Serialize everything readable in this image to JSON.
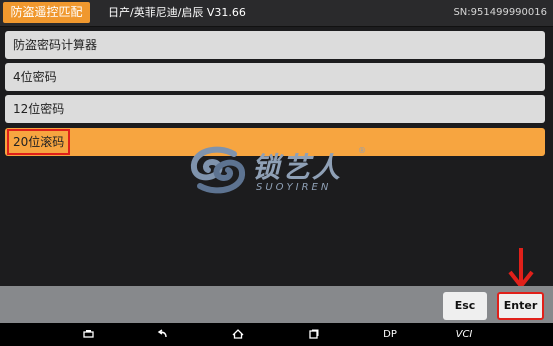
{
  "header": {
    "title": "防盗遥控匹配",
    "path": "日产/英菲尼迪/启辰  V31.66",
    "serial": "SN:951499990016"
  },
  "menu": {
    "items": [
      {
        "label": "防盗密码计算器"
      },
      {
        "label": "4位密码"
      },
      {
        "label": "12位密码"
      },
      {
        "label": "20位滚码",
        "selected": true
      }
    ]
  },
  "watermark": {
    "brand": "锁艺人",
    "sub": "SUOYIREN",
    "reg": "®"
  },
  "footer": {
    "esc_label": "Esc",
    "enter_label": "Enter"
  },
  "navbar": {
    "items": [
      "print-icon",
      "back-icon",
      "home-icon",
      "recents-icon",
      "DP",
      "VCI"
    ],
    "dp_label": "DP",
    "vci_label": "VCI"
  },
  "colors": {
    "accent": "#f7a540",
    "highlight": "#e0201a",
    "item_bg": "#dcdcdc",
    "background": "#1c1c1e"
  }
}
